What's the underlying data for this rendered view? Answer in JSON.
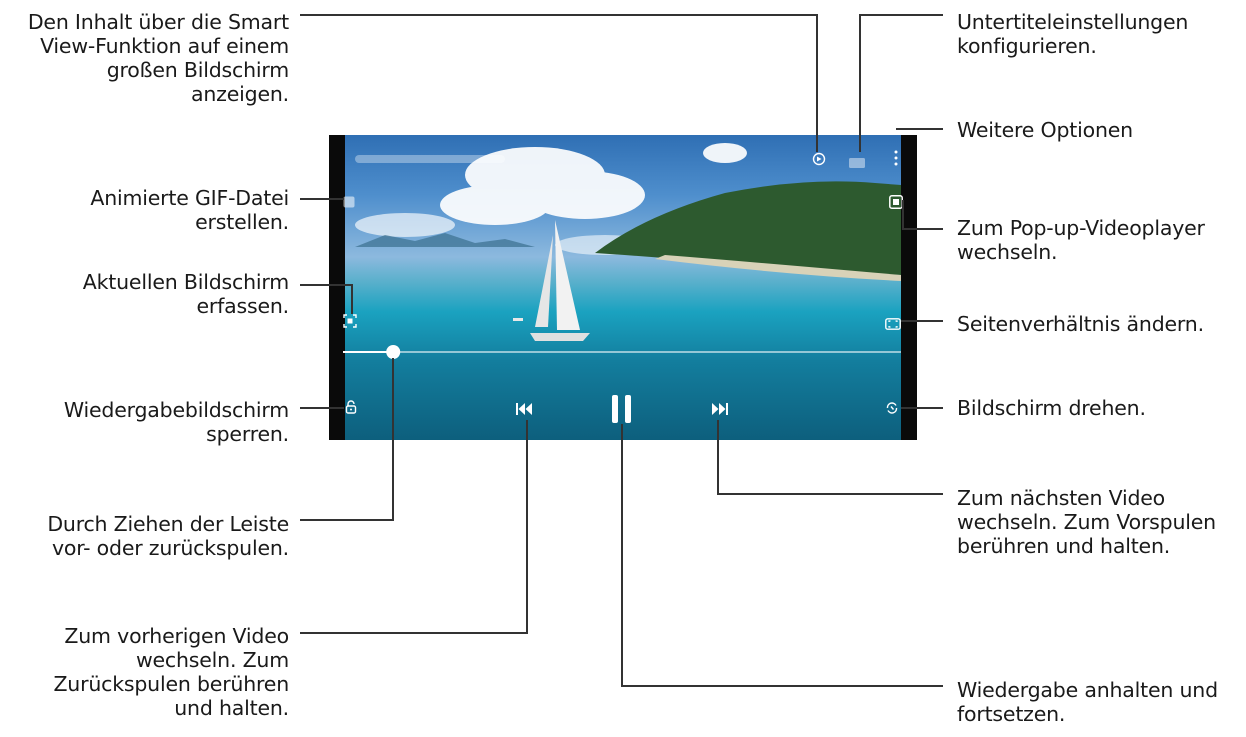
{
  "callouts": {
    "smart_view": [
      "Den Inhalt über die Smart",
      "View-Funktion auf einem",
      "großen Bildschirm",
      "anzeigen."
    ],
    "gif": [
      "Animierte GIF-Datei",
      "erstellen."
    ],
    "capture": [
      "Aktuellen Bildschirm",
      "erfassen."
    ],
    "lock": [
      "Wiedergabebildschirm",
      "sperren."
    ],
    "seek": [
      "Durch Ziehen der Leiste",
      "vor- oder zurückspulen."
    ],
    "previous": [
      "Zum vorherigen Video",
      "wechseln. Zum",
      "Zurückspulen berühren",
      "und halten."
    ],
    "subtitles": [
      "Untertiteleinstellungen",
      "konfigurieren."
    ],
    "more_options": [
      "Weitere Optionen"
    ],
    "popup": [
      "Zum Pop-up-Videoplayer",
      "wechseln."
    ],
    "aspect": [
      "Seitenverhältnis ändern."
    ],
    "rotate": [
      "Bildschirm drehen."
    ],
    "next": [
      "Zum nächsten Video",
      "wechseln. Zum Vorspulen",
      "berühren und halten."
    ],
    "pause": [
      "Wiedergabe anhalten und",
      "fortsetzen."
    ]
  },
  "player": {
    "progress": 0.09,
    "colors": {
      "accent": "#ffffff",
      "line": "#333333"
    }
  },
  "icons": {
    "smart_view": "smart-view-icon",
    "subtitles": "subtitles-icon",
    "more": "more-vertical-icon",
    "gif": "gif-icon",
    "capture": "capture-icon",
    "popup": "popup-player-icon",
    "aspect": "aspect-ratio-icon",
    "lock": "lock-icon",
    "rotate": "rotate-icon",
    "previous": "skip-previous-icon",
    "pause": "pause-icon",
    "next": "skip-next-icon"
  }
}
